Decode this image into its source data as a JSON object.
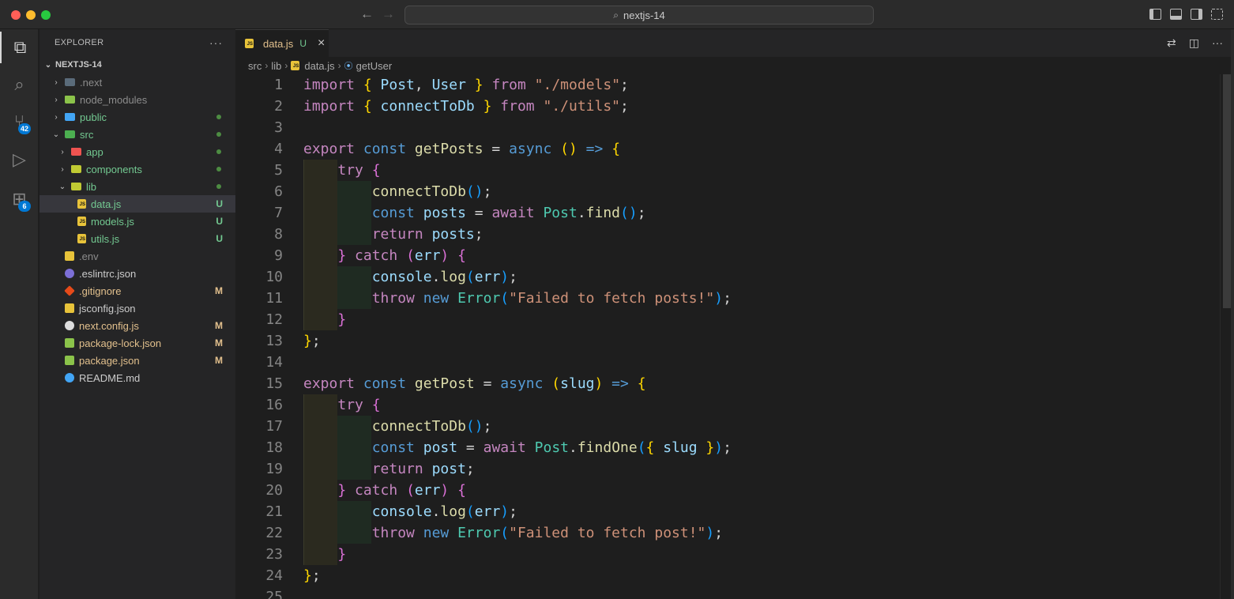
{
  "window": {
    "title": "nextjs-14",
    "nav_back_icon": "arrow-left-icon",
    "nav_forward_icon": "arrow-right-icon"
  },
  "activity_bar": {
    "items": [
      {
        "name": "explorer-icon",
        "glyph": "⧉",
        "active": true
      },
      {
        "name": "search-icon",
        "glyph": "⌕"
      },
      {
        "name": "source-control-icon",
        "glyph": "⑂",
        "badge": "42"
      },
      {
        "name": "run-debug-icon",
        "glyph": "▷"
      },
      {
        "name": "extensions-icon",
        "glyph": "⊞",
        "badge": "6"
      }
    ]
  },
  "sidebar": {
    "title": "EXPLORER",
    "more": "···",
    "root": "NEXTJS-14",
    "tree": [
      {
        "label": ".next",
        "indent": 0,
        "chevron": "right",
        "icon": "folder",
        "color": "#5a6b7a",
        "text_color": "#8c8c8c"
      },
      {
        "label": "node_modules",
        "indent": 0,
        "chevron": "right",
        "icon": "folder",
        "color": "#8bc34a",
        "text_color": "#8c8c8c"
      },
      {
        "label": "public",
        "indent": 0,
        "chevron": "right",
        "icon": "folder",
        "color": "#42a5f5",
        "text_color": "#73c991",
        "dot": true
      },
      {
        "label": "src",
        "indent": 0,
        "chevron": "down",
        "icon": "folder",
        "color": "#4caf50",
        "text_color": "#73c991",
        "dot": true
      },
      {
        "label": "app",
        "indent": 1,
        "chevron": "right",
        "icon": "folder",
        "color": "#ef5350",
        "text_color": "#73c991",
        "dot": true
      },
      {
        "label": "components",
        "indent": 1,
        "chevron": "right",
        "icon": "folder",
        "color": "#c0ca33",
        "text_color": "#73c991",
        "dot": true
      },
      {
        "label": "lib",
        "indent": 1,
        "chevron": "down",
        "icon": "folder",
        "color": "#c0ca33",
        "text_color": "#73c991",
        "dot": true
      },
      {
        "label": "data.js",
        "indent": 2,
        "icon": "js",
        "text_color": "#73c991",
        "status": "U",
        "selected": true
      },
      {
        "label": "models.js",
        "indent": 2,
        "icon": "js",
        "text_color": "#73c991",
        "status": "U"
      },
      {
        "label": "utils.js",
        "indent": 2,
        "icon": "js",
        "text_color": "#73c991",
        "status": "U"
      },
      {
        "label": ".env",
        "indent": 0,
        "icon": "env",
        "color": "#e8c33a",
        "text_color": "#8c8c8c"
      },
      {
        "label": ".eslintrc.json",
        "indent": 0,
        "icon": "eslint",
        "color": "#7c6fd6",
        "text_color": "#cccccc"
      },
      {
        "label": ".gitignore",
        "indent": 0,
        "icon": "git",
        "color": "#e64a19",
        "text_color": "#e2c08d",
        "status": "M"
      },
      {
        "label": "jsconfig.json",
        "indent": 0,
        "icon": "json",
        "color": "#e8c33a",
        "text_color": "#cccccc"
      },
      {
        "label": "next.config.js",
        "indent": 0,
        "icon": "next",
        "color": "#dddddd",
        "text_color": "#e2c08d",
        "status": "M"
      },
      {
        "label": "package-lock.json",
        "indent": 0,
        "icon": "node",
        "color": "#8bc34a",
        "text_color": "#e2c08d",
        "status": "M"
      },
      {
        "label": "package.json",
        "indent": 0,
        "icon": "node",
        "color": "#8bc34a",
        "text_color": "#e2c08d",
        "status": "M"
      },
      {
        "label": "README.md",
        "indent": 0,
        "icon": "info",
        "color": "#42a5f5",
        "text_color": "#cccccc"
      }
    ]
  },
  "tab": {
    "label": "data.js",
    "status": "U",
    "close": "×"
  },
  "breadcrumbs": [
    "src",
    "lib",
    "data.js",
    "getUser"
  ],
  "editor": {
    "lines": [
      {
        "n": "1",
        "t": [
          [
            "kw",
            "import "
          ],
          [
            "b1",
            "{ "
          ],
          [
            "var",
            "Post"
          ],
          [
            "pl",
            ", "
          ],
          [
            "var",
            "User"
          ],
          [
            "b1",
            " }"
          ],
          [
            "kw",
            " from "
          ],
          [
            "str",
            "\"./models\""
          ],
          [
            "pl",
            ";"
          ]
        ]
      },
      {
        "n": "2",
        "t": [
          [
            "kw",
            "import "
          ],
          [
            "b1",
            "{ "
          ],
          [
            "var",
            "connectToDb"
          ],
          [
            "b1",
            " }"
          ],
          [
            "kw",
            " from "
          ],
          [
            "str",
            "\"./utils\""
          ],
          [
            "pl",
            ";"
          ]
        ]
      },
      {
        "n": "3",
        "t": []
      },
      {
        "n": "4",
        "t": [
          [
            "kw",
            "export "
          ],
          [
            "st",
            "const "
          ],
          [
            "fn",
            "getPosts"
          ],
          [
            "pl",
            " = "
          ],
          [
            "st",
            "async "
          ],
          [
            "b1",
            "()"
          ],
          [
            "st",
            " => "
          ],
          [
            "b1",
            "{"
          ]
        ]
      },
      {
        "n": "5",
        "g": 1,
        "t": [
          [
            "pl",
            "    "
          ],
          [
            "kw",
            "try "
          ],
          [
            "b2",
            "{"
          ]
        ]
      },
      {
        "n": "6",
        "g": 2,
        "t": [
          [
            "pl",
            "        "
          ],
          [
            "fn",
            "connectToDb"
          ],
          [
            "b3",
            "()"
          ],
          [
            "pl",
            ";"
          ]
        ]
      },
      {
        "n": "7",
        "g": 2,
        "t": [
          [
            "pl",
            "        "
          ],
          [
            "st",
            "const "
          ],
          [
            "var",
            "posts"
          ],
          [
            "pl",
            " = "
          ],
          [
            "kw",
            "await "
          ],
          [
            "cls",
            "Post"
          ],
          [
            "pl",
            "."
          ],
          [
            "fn",
            "find"
          ],
          [
            "b3",
            "()"
          ],
          [
            "pl",
            ";"
          ]
        ]
      },
      {
        "n": "8",
        "g": 2,
        "t": [
          [
            "pl",
            "        "
          ],
          [
            "kw",
            "return "
          ],
          [
            "var",
            "posts"
          ],
          [
            "pl",
            ";"
          ]
        ]
      },
      {
        "n": "9",
        "g": 1,
        "t": [
          [
            "pl",
            "    "
          ],
          [
            "b2",
            "}"
          ],
          [
            "kw",
            " catch "
          ],
          [
            "b2",
            "("
          ],
          [
            "var",
            "err"
          ],
          [
            "b2",
            ")"
          ],
          [
            "b2",
            " {"
          ]
        ]
      },
      {
        "n": "10",
        "g": 2,
        "t": [
          [
            "pl",
            "        "
          ],
          [
            "var",
            "console"
          ],
          [
            "pl",
            "."
          ],
          [
            "fn",
            "log"
          ],
          [
            "b3",
            "("
          ],
          [
            "var",
            "err"
          ],
          [
            "b3",
            ")"
          ],
          [
            "pl",
            ";"
          ]
        ]
      },
      {
        "n": "11",
        "g": 2,
        "t": [
          [
            "pl",
            "        "
          ],
          [
            "kw",
            "throw "
          ],
          [
            "st",
            "new "
          ],
          [
            "cls",
            "Error"
          ],
          [
            "b3",
            "("
          ],
          [
            "str",
            "\"Failed to fetch posts!\""
          ],
          [
            "b3",
            ")"
          ],
          [
            "pl",
            ";"
          ]
        ]
      },
      {
        "n": "12",
        "g": 1,
        "t": [
          [
            "pl",
            "    "
          ],
          [
            "b2",
            "}"
          ]
        ]
      },
      {
        "n": "13",
        "t": [
          [
            "b1",
            "}"
          ],
          [
            "pl",
            ";"
          ]
        ]
      },
      {
        "n": "14",
        "t": []
      },
      {
        "n": "15",
        "t": [
          [
            "kw",
            "export "
          ],
          [
            "st",
            "const "
          ],
          [
            "fn",
            "getPost"
          ],
          [
            "pl",
            " = "
          ],
          [
            "st",
            "async "
          ],
          [
            "b1",
            "("
          ],
          [
            "var",
            "slug"
          ],
          [
            "b1",
            ")"
          ],
          [
            "st",
            " => "
          ],
          [
            "b1",
            "{"
          ]
        ]
      },
      {
        "n": "16",
        "g": 1,
        "t": [
          [
            "pl",
            "    "
          ],
          [
            "kw",
            "try "
          ],
          [
            "b2",
            "{"
          ]
        ]
      },
      {
        "n": "17",
        "g": 2,
        "t": [
          [
            "pl",
            "        "
          ],
          [
            "fn",
            "connectToDb"
          ],
          [
            "b3",
            "()"
          ],
          [
            "pl",
            ";"
          ]
        ]
      },
      {
        "n": "18",
        "g": 2,
        "t": [
          [
            "pl",
            "        "
          ],
          [
            "st",
            "const "
          ],
          [
            "var",
            "post"
          ],
          [
            "pl",
            " = "
          ],
          [
            "kw",
            "await "
          ],
          [
            "cls",
            "Post"
          ],
          [
            "pl",
            "."
          ],
          [
            "fn",
            "findOne"
          ],
          [
            "b3",
            "("
          ],
          [
            "b1",
            "{ "
          ],
          [
            "var",
            "slug"
          ],
          [
            "b1",
            " }"
          ],
          [
            "b3",
            ")"
          ],
          [
            "pl",
            ";"
          ]
        ]
      },
      {
        "n": "19",
        "g": 2,
        "t": [
          [
            "pl",
            "        "
          ],
          [
            "kw",
            "return "
          ],
          [
            "var",
            "post"
          ],
          [
            "pl",
            ";"
          ]
        ]
      },
      {
        "n": "20",
        "g": 1,
        "t": [
          [
            "pl",
            "    "
          ],
          [
            "b2",
            "}"
          ],
          [
            "kw",
            " catch "
          ],
          [
            "b2",
            "("
          ],
          [
            "var",
            "err"
          ],
          [
            "b2",
            ")"
          ],
          [
            "b2",
            " {"
          ]
        ]
      },
      {
        "n": "21",
        "g": 2,
        "t": [
          [
            "pl",
            "        "
          ],
          [
            "var",
            "console"
          ],
          [
            "pl",
            "."
          ],
          [
            "fn",
            "log"
          ],
          [
            "b3",
            "("
          ],
          [
            "var",
            "err"
          ],
          [
            "b3",
            ")"
          ],
          [
            "pl",
            ";"
          ]
        ]
      },
      {
        "n": "22",
        "g": 2,
        "t": [
          [
            "pl",
            "        "
          ],
          [
            "kw",
            "throw "
          ],
          [
            "st",
            "new "
          ],
          [
            "cls",
            "Error"
          ],
          [
            "b3",
            "("
          ],
          [
            "str",
            "\"Failed to fetch post!\""
          ],
          [
            "b3",
            ")"
          ],
          [
            "pl",
            ";"
          ]
        ]
      },
      {
        "n": "23",
        "g": 1,
        "t": [
          [
            "pl",
            "    "
          ],
          [
            "b2",
            "}"
          ]
        ]
      },
      {
        "n": "24",
        "t": [
          [
            "b1",
            "}"
          ],
          [
            "pl",
            ";"
          ]
        ]
      },
      {
        "n": "25",
        "t": []
      }
    ]
  }
}
